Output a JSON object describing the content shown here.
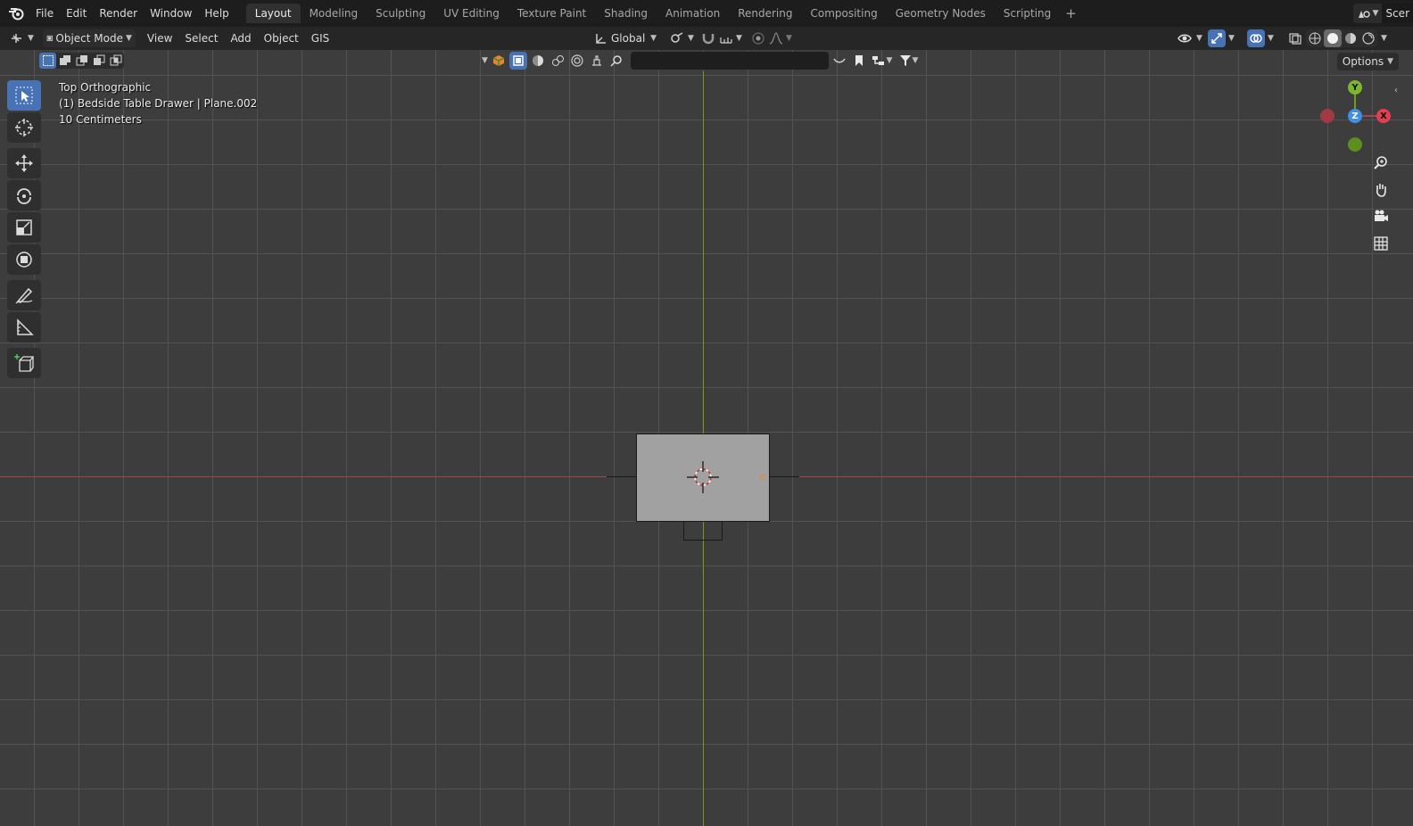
{
  "topbar": {
    "menus": [
      "File",
      "Edit",
      "Render",
      "Window",
      "Help"
    ],
    "workspaces": [
      "Layout",
      "Modeling",
      "Sculpting",
      "UV Editing",
      "Texture Paint",
      "Shading",
      "Animation",
      "Rendering",
      "Compositing",
      "Geometry Nodes",
      "Scripting"
    ],
    "active_workspace": "Layout",
    "add_tab": "+",
    "scene_label": "Scer"
  },
  "header": {
    "mode": "Object Mode",
    "menus": [
      "View",
      "Select",
      "Add",
      "Object",
      "GIS"
    ],
    "transform_orientation": "Global"
  },
  "viewport_toolbar": {
    "search_placeholder": "",
    "options_label": "Options"
  },
  "overlay": {
    "view_name": "Top Orthographic",
    "object_info": "(1) Bedside Table Drawer | Plane.002",
    "grid_scale": "10 Centimeters"
  },
  "gizmo": {
    "x_label": "X",
    "y_label": "Y",
    "z_label": "Z"
  },
  "colors": {
    "x_axis": "#a4434c",
    "y_axis": "#6f9b25",
    "accent": "#4772b3",
    "origin": "#e8842a"
  }
}
